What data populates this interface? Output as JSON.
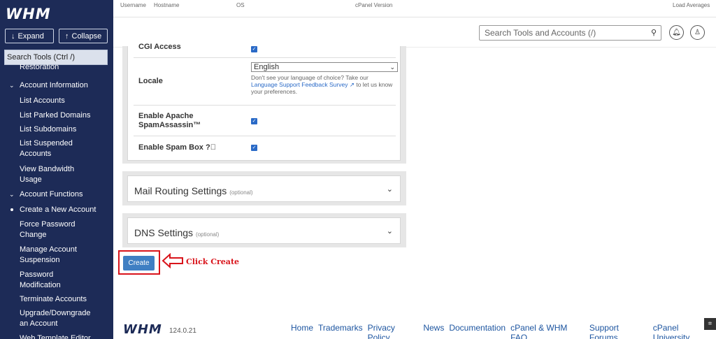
{
  "sidebar": {
    "logo": "WHM",
    "expand_label": "Expand",
    "collapse_label": "Collapse",
    "search_placeholder": "Search Tools (Ctrl /)",
    "partial_item": "Restoration",
    "group_account_information": "Account Information",
    "items_info": [
      "List Accounts",
      "List Parked Domains",
      "List Subdomains",
      "List Suspended Accounts",
      "View Bandwidth Usage"
    ],
    "group_account_functions": "Account Functions",
    "items_functions": [
      "Create a New Account",
      "Force Password Change",
      "Manage Account Suspension",
      "Password Modification",
      "Terminate Accounts",
      "Upgrade/Downgrade an Account",
      "Web Template Editor"
    ]
  },
  "topbar": {
    "username": "Username",
    "hostname": "Hostname",
    "os": "OS",
    "cpanel_version": "cPanel Version",
    "load_averages": "Load Averages"
  },
  "header": {
    "search_placeholder": "Search Tools and Accounts (/)"
  },
  "form": {
    "cgi_access": "CGI Access",
    "locale_label": "Locale",
    "locale_value": "English",
    "locale_hint_pre": "Don't see your language of choice? Take our",
    "locale_hint_link": "Language Support Feedback Survey",
    "locale_hint_post": "to let us know your preferences.",
    "spamassassin_label": "Enable Apache SpamAssassin™",
    "spambox_label": "Enable Spam Box"
  },
  "sections": {
    "mail_routing": "Mail Routing Settings",
    "dns": "DNS Settings",
    "optional": "(optional)"
  },
  "create_label": "Create",
  "annotation": "Click Create",
  "footer": {
    "logo": "WHM",
    "version": "124.0.21",
    "links": [
      "Home",
      "Trademarks",
      "Privacy Policy",
      "News",
      "Documentation",
      "cPanel & WHM FAQ",
      "Support Forums",
      "cPanel University"
    ]
  }
}
